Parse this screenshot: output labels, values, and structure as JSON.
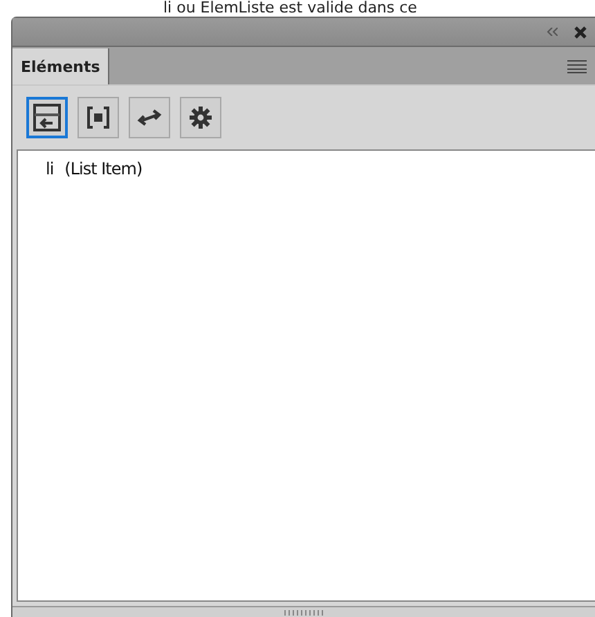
{
  "caption": "li ou ElemListe est valide dans ce",
  "panel": {
    "tabs": [
      {
        "label": "Eléments",
        "selected": true
      }
    ]
  },
  "toolbar": [
    {
      "kind": "structure",
      "selected": true
    },
    {
      "kind": "bracket",
      "selected": false
    },
    {
      "kind": "swap",
      "selected": false
    },
    {
      "kind": "gear",
      "selected": false
    }
  ],
  "items": [
    {
      "name": "li",
      "description": "(List Item)"
    }
  ]
}
